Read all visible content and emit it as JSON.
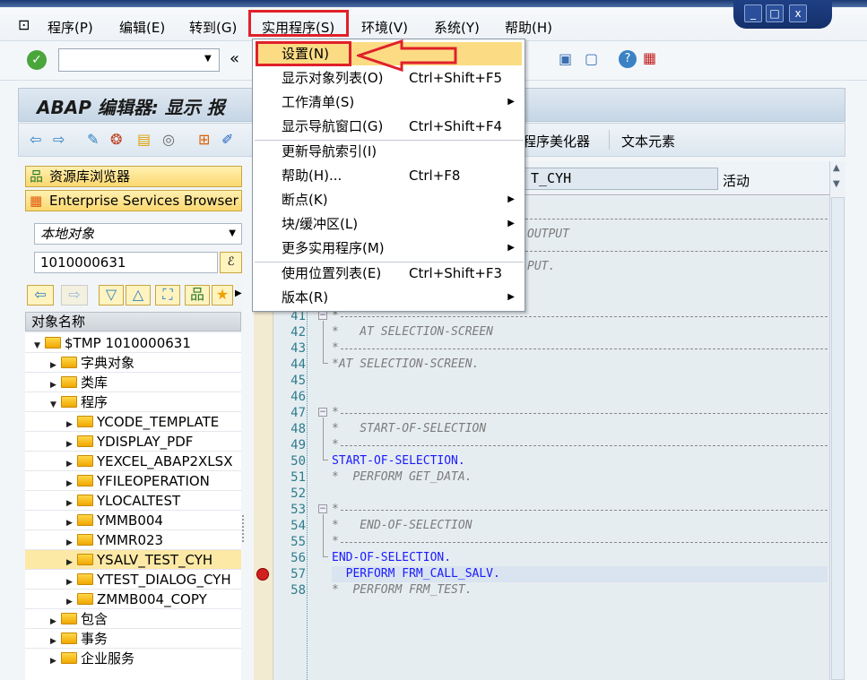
{
  "menubar": {
    "items": [
      "程序(P)",
      "编辑(E)",
      "转到(G)",
      "实用程序(S)",
      "环境(V)",
      "系统(Y)",
      "帮助(H)"
    ]
  },
  "window_controls": {
    "minimize": "_",
    "maximize": "□",
    "close": "x"
  },
  "toolbar": {
    "command_field": "",
    "nav_back": "«"
  },
  "title": "ABAP 编辑器: 显示 报",
  "app_toolbar": {
    "pretty_printer": "程序美化器",
    "text_elements": "文本元素"
  },
  "left": {
    "repo_browser": "资源库浏览器",
    "es_browser": "Enterprise Services Browser",
    "object_type": "本地对象",
    "object_name": "1010000631",
    "tree_header": "对象名称",
    "tree": [
      {
        "label": "$TMP 1010000631",
        "level": 0,
        "expanded": true
      },
      {
        "label": "字典对象",
        "level": 1
      },
      {
        "label": "类库",
        "level": 1
      },
      {
        "label": "程序",
        "level": 1,
        "expanded": true
      },
      {
        "label": "YCODE_TEMPLATE",
        "level": 2
      },
      {
        "label": "YDISPLAY_PDF",
        "level": 2
      },
      {
        "label": "YEXCEL_ABAP2XLSX",
        "level": 2
      },
      {
        "label": "YFILEOPERATION",
        "level": 2
      },
      {
        "label": "YLOCALTEST",
        "level": 2
      },
      {
        "label": "YMMB004",
        "level": 2
      },
      {
        "label": "YMMR023",
        "level": 2
      },
      {
        "label": "YSALV_TEST_CYH",
        "level": 2,
        "selected": true
      },
      {
        "label": "YTEST_DIALOG_CYH",
        "level": 2
      },
      {
        "label": "ZMMB004_COPY",
        "level": 2
      },
      {
        "label": "包含",
        "level": 1
      },
      {
        "label": "事务",
        "level": 1
      },
      {
        "label": "企业服务",
        "level": 1
      }
    ]
  },
  "editor": {
    "program_field": "T_CYH",
    "status": "活动",
    "hidden_fragments": [
      "OUTPUT",
      "PUT."
    ],
    "lines": [
      {
        "n": "41",
        "text": "*",
        "dash": true,
        "fold": "start"
      },
      {
        "n": "42",
        "text": "*   AT SELECTION-SCREEN"
      },
      {
        "n": "43",
        "text": "*",
        "dash": true
      },
      {
        "n": "44",
        "text": "*AT SELECTION-SCREEN."
      },
      {
        "n": "45",
        "text": ""
      },
      {
        "n": "46",
        "text": ""
      },
      {
        "n": "47",
        "text": "*",
        "dash": true,
        "fold": "start"
      },
      {
        "n": "48",
        "text": "*   START-OF-SELECTION"
      },
      {
        "n": "49",
        "text": "*",
        "dash": true
      },
      {
        "n": "50",
        "text": "START-OF-SELECTION.",
        "kw": true
      },
      {
        "n": "51",
        "text": "*  PERFORM GET_DATA."
      },
      {
        "n": "52",
        "text": ""
      },
      {
        "n": "53",
        "text": "*",
        "dash": true,
        "fold": "start"
      },
      {
        "n": "54",
        "text": "*   END-OF-SELECTION"
      },
      {
        "n": "55",
        "text": "*",
        "dash": true
      },
      {
        "n": "56",
        "text": "END-OF-SELECTION.",
        "kw": true
      },
      {
        "n": "57",
        "text": "  PERFORM FRM_CALL_SALV.",
        "kw": true,
        "highlight": true,
        "breakpoint": true
      },
      {
        "n": "58",
        "text": "*  PERFORM FRM_TEST."
      }
    ]
  },
  "dropdown_menu": {
    "items": [
      {
        "label": "设置(N)",
        "shortcut": "",
        "submenu": false,
        "highlighted": true
      },
      {
        "label": "显示对象列表(O)",
        "shortcut": "Ctrl+Shift+F5",
        "submenu": false
      },
      {
        "label": "工作清单(S)",
        "shortcut": "",
        "submenu": true
      },
      {
        "label": "显示导航窗口(G)",
        "shortcut": "Ctrl+Shift+F4",
        "submenu": false
      },
      {
        "label": "更新导航索引(I)",
        "shortcut": "",
        "submenu": false,
        "sep_before": true
      },
      {
        "label": "帮助(H)...",
        "shortcut": "Ctrl+F8",
        "submenu": false
      },
      {
        "label": "断点(K)",
        "shortcut": "",
        "submenu": true
      },
      {
        "label": "块/缓冲区(L)",
        "shortcut": "",
        "submenu": true
      },
      {
        "label": "更多实用程序(M)",
        "shortcut": "",
        "submenu": true
      },
      {
        "label": "使用位置列表(E)",
        "shortcut": "Ctrl+Shift+F3",
        "submenu": false,
        "sep_before": true
      },
      {
        "label": "版本(R)",
        "shortcut": "",
        "submenu": true
      }
    ]
  },
  "colors": {
    "highlight": "#fbdc84",
    "annotation_red": "#e0202a",
    "keyword": "#1a1aff",
    "comment": "#7b7b7b"
  }
}
